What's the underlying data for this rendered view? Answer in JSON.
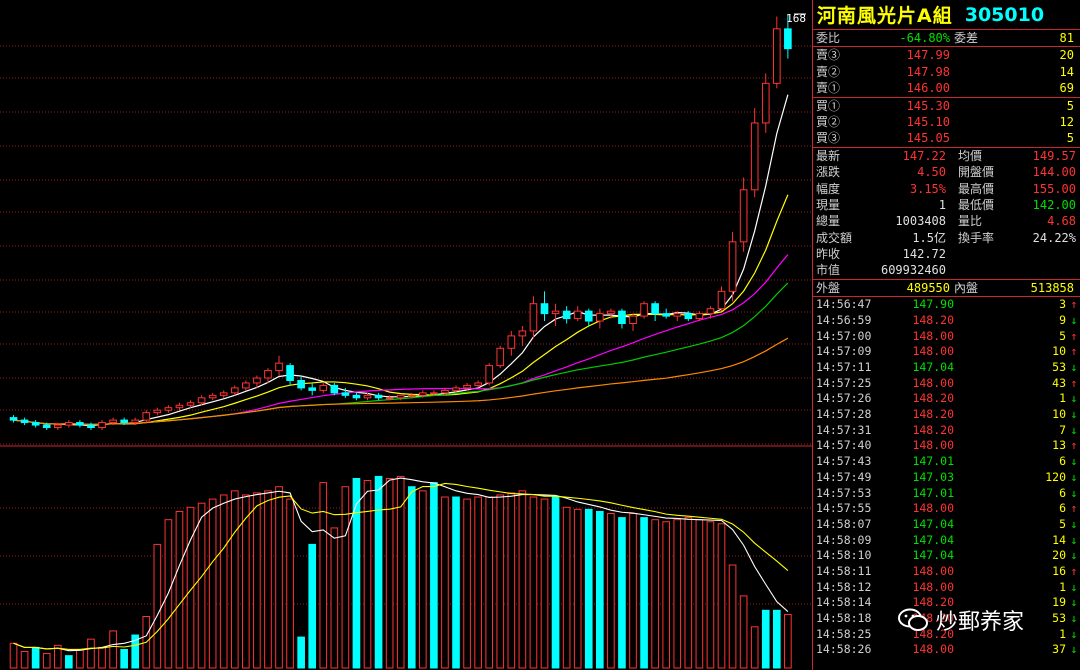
{
  "header": {
    "name": "河南風光片A組",
    "code": "305010",
    "top_price": "168"
  },
  "order": {
    "ratio_label": "委比",
    "ratio_value": "-64.80%",
    "diff_label": "委差",
    "diff_value": "81"
  },
  "asks": [
    {
      "label": "賣③",
      "price": "147.99",
      "vol": "20"
    },
    {
      "label": "賣②",
      "price": "147.98",
      "vol": "14"
    },
    {
      "label": "賣①",
      "price": "146.00",
      "vol": "69"
    }
  ],
  "bids": [
    {
      "label": "買①",
      "price": "145.30",
      "vol": "5"
    },
    {
      "label": "買②",
      "price": "145.10",
      "vol": "12"
    },
    {
      "label": "買③",
      "price": "145.05",
      "vol": "5"
    }
  ],
  "stats": [
    {
      "l1": "最新",
      "v1": "147.22",
      "c1": "red",
      "l2": "均價",
      "v2": "149.57",
      "c2": "red"
    },
    {
      "l1": "漲跌",
      "v1": "4.50",
      "c1": "red",
      "l2": "開盤價",
      "v2": "144.00",
      "c2": "red"
    },
    {
      "l1": "幅度",
      "v1": "3.15%",
      "c1": "red",
      "l2": "最高價",
      "v2": "155.00",
      "c2": "red"
    },
    {
      "l1": "現量",
      "v1": "1",
      "c1": "wht",
      "l2": "最低價",
      "v2": "142.00",
      "c2": "grn"
    },
    {
      "l1": "總量",
      "v1": "1003408",
      "c1": "wht",
      "l2": "量比",
      "v2": "4.68",
      "c2": "red"
    },
    {
      "l1": "成交額",
      "v1": "1.5亿",
      "c1": "wht",
      "l2": "換手率",
      "v2": "24.22%",
      "c2": "wht"
    },
    {
      "l1": "昨收",
      "v1": "142.72",
      "c1": "wht",
      "l2": "",
      "v2": "",
      "c2": "wht"
    },
    {
      "l1": "市值",
      "v1": "609932460",
      "c1": "wht",
      "l2": "",
      "v2": "",
      "c2": "wht"
    }
  ],
  "outer": {
    "label": "外盤",
    "value": "489550",
    "inner_label": "內盤",
    "inner_value": "513858"
  },
  "ticks": [
    {
      "time": "14:56:47",
      "price": "147.90",
      "vol": "3",
      "dir": "up"
    },
    {
      "time": "14:56:59",
      "price": "148.20",
      "vol": "9",
      "dir": "down"
    },
    {
      "time": "14:57:00",
      "price": "148.00",
      "vol": "5",
      "dir": "up"
    },
    {
      "time": "14:57:09",
      "price": "148.00",
      "vol": "10",
      "dir": "up"
    },
    {
      "time": "14:57:11",
      "price": "147.04",
      "vol": "53",
      "dir": "down"
    },
    {
      "time": "14:57:25",
      "price": "148.00",
      "vol": "43",
      "dir": "up"
    },
    {
      "time": "14:57:26",
      "price": "148.20",
      "vol": "1",
      "dir": "down"
    },
    {
      "time": "14:57:28",
      "price": "148.20",
      "vol": "10",
      "dir": "down"
    },
    {
      "time": "14:57:31",
      "price": "148.20",
      "vol": "7",
      "dir": "down"
    },
    {
      "time": "14:57:40",
      "price": "148.00",
      "vol": "13",
      "dir": "up"
    },
    {
      "time": "14:57:43",
      "price": "147.01",
      "vol": "6",
      "dir": "down"
    },
    {
      "time": "14:57:49",
      "price": "147.03",
      "vol": "120",
      "dir": "down"
    },
    {
      "time": "14:57:53",
      "price": "147.01",
      "vol": "6",
      "dir": "down"
    },
    {
      "time": "14:57:55",
      "price": "148.00",
      "vol": "6",
      "dir": "up"
    },
    {
      "time": "14:58:07",
      "price": "147.04",
      "vol": "5",
      "dir": "down"
    },
    {
      "time": "14:58:09",
      "price": "147.04",
      "vol": "14",
      "dir": "down"
    },
    {
      "time": "14:58:10",
      "price": "147.04",
      "vol": "20",
      "dir": "down"
    },
    {
      "time": "14:58:11",
      "price": "148.00",
      "vol": "16",
      "dir": "up"
    },
    {
      "time": "14:58:12",
      "price": "148.00",
      "vol": "1",
      "dir": "down"
    },
    {
      "time": "14:58:14",
      "price": "148.20",
      "vol": "19",
      "dir": "down"
    },
    {
      "time": "14:58:18",
      "price": "148.20",
      "vol": "53",
      "dir": "down"
    },
    {
      "time": "14:58:25",
      "price": "148.20",
      "vol": "1",
      "dir": "down"
    },
    {
      "time": "14:58:26",
      "price": "148.00",
      "vol": "37",
      "dir": "down"
    }
  ],
  "watermark": "炒郵养家",
  "colors": {
    "up": "#ff3333",
    "down": "#00ffff",
    "grid": "#c8282a",
    "ma5": "#ffffff",
    "ma10": "#ffff00",
    "ma20": "#ff00ff",
    "ma30": "#00cc00",
    "ma60": "#ff8800"
  },
  "chart_data": {
    "type": "candlestick",
    "candles": [
      [
        143,
        144,
        141,
        142
      ],
      [
        142,
        143,
        140,
        141
      ],
      [
        141,
        142,
        139,
        140
      ],
      [
        140,
        141,
        138,
        139
      ],
      [
        139,
        141,
        138,
        140
      ],
      [
        140,
        142,
        139,
        141
      ],
      [
        141,
        142,
        139,
        140
      ],
      [
        140,
        141,
        138,
        139
      ],
      [
        139,
        142,
        138,
        141
      ],
      [
        141,
        143,
        140,
        142
      ],
      [
        142,
        143,
        140,
        141
      ],
      [
        141,
        143,
        140,
        142
      ],
      [
        142,
        146,
        141,
        145
      ],
      [
        145,
        147,
        144,
        146
      ],
      [
        146,
        148,
        145,
        147
      ],
      [
        147,
        149,
        146,
        148
      ],
      [
        148,
        150,
        147,
        149
      ],
      [
        149,
        152,
        148,
        151
      ],
      [
        151,
        153,
        150,
        152
      ],
      [
        152,
        154,
        151,
        153
      ],
      [
        153,
        156,
        152,
        155
      ],
      [
        155,
        158,
        154,
        157
      ],
      [
        157,
        160,
        155,
        159
      ],
      [
        159,
        163,
        157,
        162
      ],
      [
        162,
        168,
        160,
        165
      ],
      [
        164,
        165,
        156,
        158
      ],
      [
        158,
        160,
        154,
        155
      ],
      [
        155,
        157,
        152,
        154
      ],
      [
        154,
        157,
        153,
        156
      ],
      [
        156,
        157,
        152,
        153
      ],
      [
        153,
        155,
        151,
        152
      ],
      [
        152,
        153,
        150,
        151
      ],
      [
        151,
        153,
        150,
        152
      ],
      [
        152,
        153,
        150,
        151
      ],
      [
        151,
        152,
        150,
        151
      ],
      [
        151,
        152,
        150,
        152
      ],
      [
        152,
        153,
        151,
        152
      ],
      [
        152,
        154,
        151,
        153
      ],
      [
        153,
        154,
        152,
        153
      ],
      [
        153,
        155,
        152,
        154
      ],
      [
        154,
        156,
        153,
        155
      ],
      [
        155,
        157,
        154,
        156
      ],
      [
        156,
        158,
        155,
        157
      ],
      [
        157,
        165,
        156,
        164
      ],
      [
        164,
        172,
        163,
        171
      ],
      [
        171,
        178,
        168,
        176
      ],
      [
        176,
        180,
        172,
        178
      ],
      [
        178,
        192,
        175,
        189
      ],
      [
        189,
        194,
        182,
        185
      ],
      [
        185,
        189,
        180,
        186
      ],
      [
        186,
        188,
        181,
        183
      ],
      [
        183,
        188,
        182,
        186
      ],
      [
        186,
        187,
        180,
        182
      ],
      [
        182,
        187,
        179,
        185
      ],
      [
        185,
        187,
        183,
        186
      ],
      [
        186,
        187,
        179,
        181
      ],
      [
        181,
        185,
        178,
        184
      ],
      [
        184,
        190,
        183,
        189
      ],
      [
        189,
        190,
        182,
        185
      ],
      [
        185,
        187,
        183,
        184
      ],
      [
        184,
        186,
        182,
        185
      ],
      [
        185,
        186,
        182,
        183
      ],
      [
        183,
        186,
        182,
        185
      ],
      [
        185,
        188,
        183,
        187
      ],
      [
        187,
        196,
        186,
        194
      ],
      [
        194,
        218,
        190,
        214
      ],
      [
        214,
        240,
        210,
        235
      ],
      [
        235,
        268,
        232,
        262
      ],
      [
        262,
        282,
        258,
        278
      ],
      [
        278,
        305,
        276,
        300
      ],
      [
        300,
        306,
        288,
        292
      ]
    ],
    "volumes": [
      [
        12,
        0
      ],
      [
        8,
        0
      ],
      [
        10,
        1
      ],
      [
        7,
        0
      ],
      [
        11,
        0
      ],
      [
        6,
        1
      ],
      [
        9,
        0
      ],
      [
        14,
        0
      ],
      [
        10,
        0
      ],
      [
        18,
        0
      ],
      [
        9,
        1
      ],
      [
        16,
        1
      ],
      [
        25,
        0
      ],
      [
        60,
        0
      ],
      [
        72,
        0
      ],
      [
        76,
        0
      ],
      [
        78,
        0
      ],
      [
        80,
        0
      ],
      [
        82,
        0
      ],
      [
        84,
        0
      ],
      [
        86,
        0
      ],
      [
        84,
        0
      ],
      [
        85,
        0
      ],
      [
        86,
        0
      ],
      [
        88,
        0
      ],
      [
        82,
        0
      ],
      [
        15,
        1
      ],
      [
        60,
        1
      ],
      [
        90,
        0
      ],
      [
        68,
        0
      ],
      [
        88,
        0
      ],
      [
        92,
        1
      ],
      [
        91,
        0
      ],
      [
        93,
        1
      ],
      [
        92,
        0
      ],
      [
        93,
        0
      ],
      [
        88,
        1
      ],
      [
        86,
        0
      ],
      [
        90,
        1
      ],
      [
        83,
        0
      ],
      [
        83,
        1
      ],
      [
        82,
        0
      ],
      [
        83,
        0
      ],
      [
        83,
        0
      ],
      [
        84,
        0
      ],
      [
        85,
        0
      ],
      [
        86,
        0
      ],
      [
        83,
        0
      ],
      [
        82,
        0
      ],
      [
        83,
        1
      ],
      [
        78,
        0
      ],
      [
        77,
        0
      ],
      [
        77,
        1
      ],
      [
        76,
        1
      ],
      [
        75,
        0
      ],
      [
        73,
        1
      ],
      [
        75,
        0
      ],
      [
        73,
        1
      ],
      [
        72,
        0
      ],
      [
        71,
        0
      ],
      [
        72,
        0
      ],
      [
        73,
        0
      ],
      [
        72,
        0
      ],
      [
        71,
        0
      ],
      [
        70,
        0
      ],
      [
        50,
        0
      ],
      [
        35,
        0
      ],
      [
        20,
        0
      ],
      [
        28,
        1
      ],
      [
        28,
        1
      ],
      [
        26,
        0
      ]
    ]
  }
}
